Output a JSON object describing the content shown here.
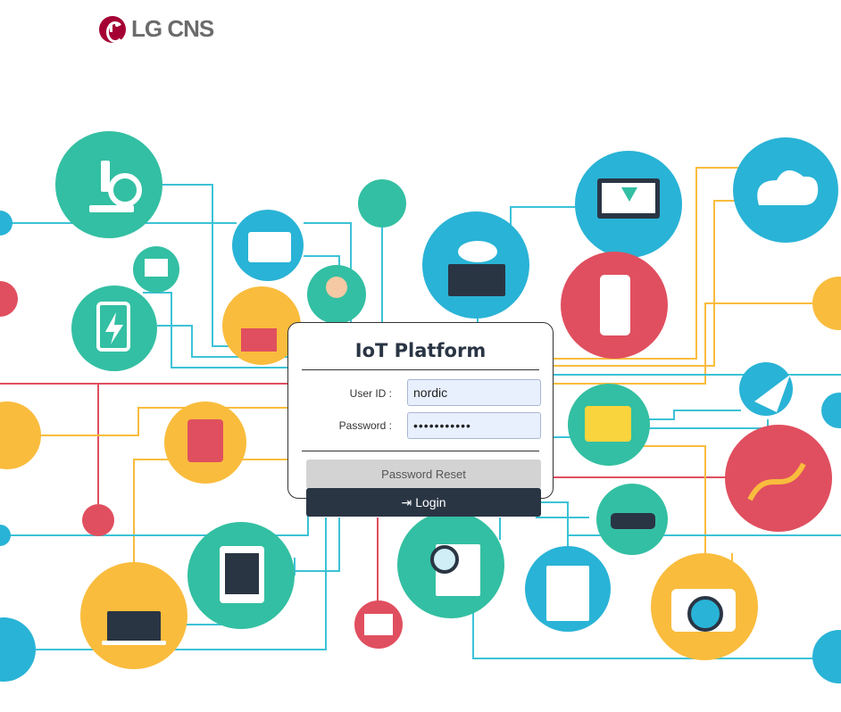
{
  "brand": {
    "logo_text": "LG CNS"
  },
  "login": {
    "title": "IoT Platform",
    "userid_label": "User ID :",
    "userid_value": "nordic",
    "password_label": "Password :",
    "password_value": "•••••••••••",
    "reset_label": "Password Reset",
    "login_label": "Login",
    "login_icon": "sign-in-icon"
  },
  "colors": {
    "teal": "#33bfa3",
    "blue": "#29b3d6",
    "red": "#e04f5f",
    "yellow": "#f9bc3d",
    "dark": "#2a3544",
    "brand": "#a50034"
  }
}
